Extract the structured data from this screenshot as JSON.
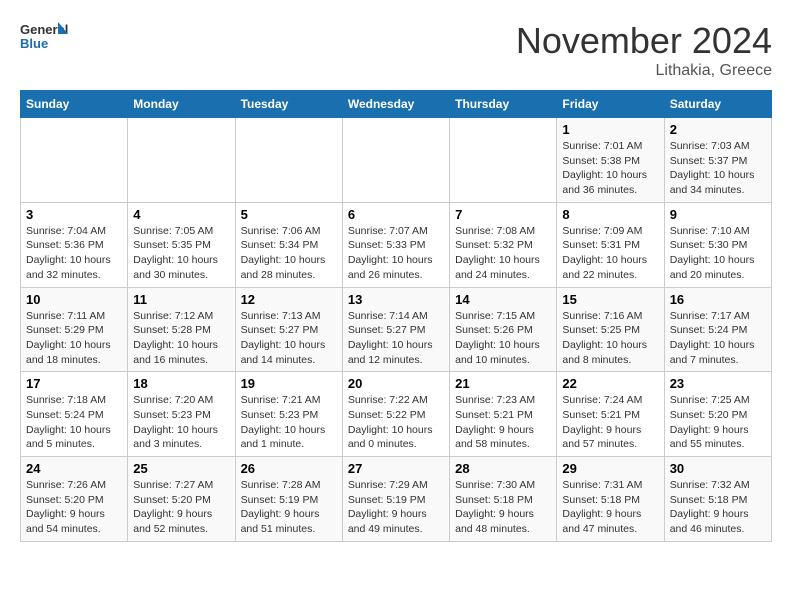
{
  "header": {
    "logo_general": "General",
    "logo_blue": "Blue",
    "month_title": "November 2024",
    "subtitle": "Lithakia, Greece"
  },
  "days_of_week": [
    "Sunday",
    "Monday",
    "Tuesday",
    "Wednesday",
    "Thursday",
    "Friday",
    "Saturday"
  ],
  "weeks": [
    [
      {
        "day": "",
        "info": ""
      },
      {
        "day": "",
        "info": ""
      },
      {
        "day": "",
        "info": ""
      },
      {
        "day": "",
        "info": ""
      },
      {
        "day": "",
        "info": ""
      },
      {
        "day": "1",
        "info": "Sunrise: 7:01 AM\nSunset: 5:38 PM\nDaylight: 10 hours and 36 minutes."
      },
      {
        "day": "2",
        "info": "Sunrise: 7:03 AM\nSunset: 5:37 PM\nDaylight: 10 hours and 34 minutes."
      }
    ],
    [
      {
        "day": "3",
        "info": "Sunrise: 7:04 AM\nSunset: 5:36 PM\nDaylight: 10 hours and 32 minutes."
      },
      {
        "day": "4",
        "info": "Sunrise: 7:05 AM\nSunset: 5:35 PM\nDaylight: 10 hours and 30 minutes."
      },
      {
        "day": "5",
        "info": "Sunrise: 7:06 AM\nSunset: 5:34 PM\nDaylight: 10 hours and 28 minutes."
      },
      {
        "day": "6",
        "info": "Sunrise: 7:07 AM\nSunset: 5:33 PM\nDaylight: 10 hours and 26 minutes."
      },
      {
        "day": "7",
        "info": "Sunrise: 7:08 AM\nSunset: 5:32 PM\nDaylight: 10 hours and 24 minutes."
      },
      {
        "day": "8",
        "info": "Sunrise: 7:09 AM\nSunset: 5:31 PM\nDaylight: 10 hours and 22 minutes."
      },
      {
        "day": "9",
        "info": "Sunrise: 7:10 AM\nSunset: 5:30 PM\nDaylight: 10 hours and 20 minutes."
      }
    ],
    [
      {
        "day": "10",
        "info": "Sunrise: 7:11 AM\nSunset: 5:29 PM\nDaylight: 10 hours and 18 minutes."
      },
      {
        "day": "11",
        "info": "Sunrise: 7:12 AM\nSunset: 5:28 PM\nDaylight: 10 hours and 16 minutes."
      },
      {
        "day": "12",
        "info": "Sunrise: 7:13 AM\nSunset: 5:27 PM\nDaylight: 10 hours and 14 minutes."
      },
      {
        "day": "13",
        "info": "Sunrise: 7:14 AM\nSunset: 5:27 PM\nDaylight: 10 hours and 12 minutes."
      },
      {
        "day": "14",
        "info": "Sunrise: 7:15 AM\nSunset: 5:26 PM\nDaylight: 10 hours and 10 minutes."
      },
      {
        "day": "15",
        "info": "Sunrise: 7:16 AM\nSunset: 5:25 PM\nDaylight: 10 hours and 8 minutes."
      },
      {
        "day": "16",
        "info": "Sunrise: 7:17 AM\nSunset: 5:24 PM\nDaylight: 10 hours and 7 minutes."
      }
    ],
    [
      {
        "day": "17",
        "info": "Sunrise: 7:18 AM\nSunset: 5:24 PM\nDaylight: 10 hours and 5 minutes."
      },
      {
        "day": "18",
        "info": "Sunrise: 7:20 AM\nSunset: 5:23 PM\nDaylight: 10 hours and 3 minutes."
      },
      {
        "day": "19",
        "info": "Sunrise: 7:21 AM\nSunset: 5:23 PM\nDaylight: 10 hours and 1 minute."
      },
      {
        "day": "20",
        "info": "Sunrise: 7:22 AM\nSunset: 5:22 PM\nDaylight: 10 hours and 0 minutes."
      },
      {
        "day": "21",
        "info": "Sunrise: 7:23 AM\nSunset: 5:21 PM\nDaylight: 9 hours and 58 minutes."
      },
      {
        "day": "22",
        "info": "Sunrise: 7:24 AM\nSunset: 5:21 PM\nDaylight: 9 hours and 57 minutes."
      },
      {
        "day": "23",
        "info": "Sunrise: 7:25 AM\nSunset: 5:20 PM\nDaylight: 9 hours and 55 minutes."
      }
    ],
    [
      {
        "day": "24",
        "info": "Sunrise: 7:26 AM\nSunset: 5:20 PM\nDaylight: 9 hours and 54 minutes."
      },
      {
        "day": "25",
        "info": "Sunrise: 7:27 AM\nSunset: 5:20 PM\nDaylight: 9 hours and 52 minutes."
      },
      {
        "day": "26",
        "info": "Sunrise: 7:28 AM\nSunset: 5:19 PM\nDaylight: 9 hours and 51 minutes."
      },
      {
        "day": "27",
        "info": "Sunrise: 7:29 AM\nSunset: 5:19 PM\nDaylight: 9 hours and 49 minutes."
      },
      {
        "day": "28",
        "info": "Sunrise: 7:30 AM\nSunset: 5:18 PM\nDaylight: 9 hours and 48 minutes."
      },
      {
        "day": "29",
        "info": "Sunrise: 7:31 AM\nSunset: 5:18 PM\nDaylight: 9 hours and 47 minutes."
      },
      {
        "day": "30",
        "info": "Sunrise: 7:32 AM\nSunset: 5:18 PM\nDaylight: 9 hours and 46 minutes."
      }
    ]
  ]
}
